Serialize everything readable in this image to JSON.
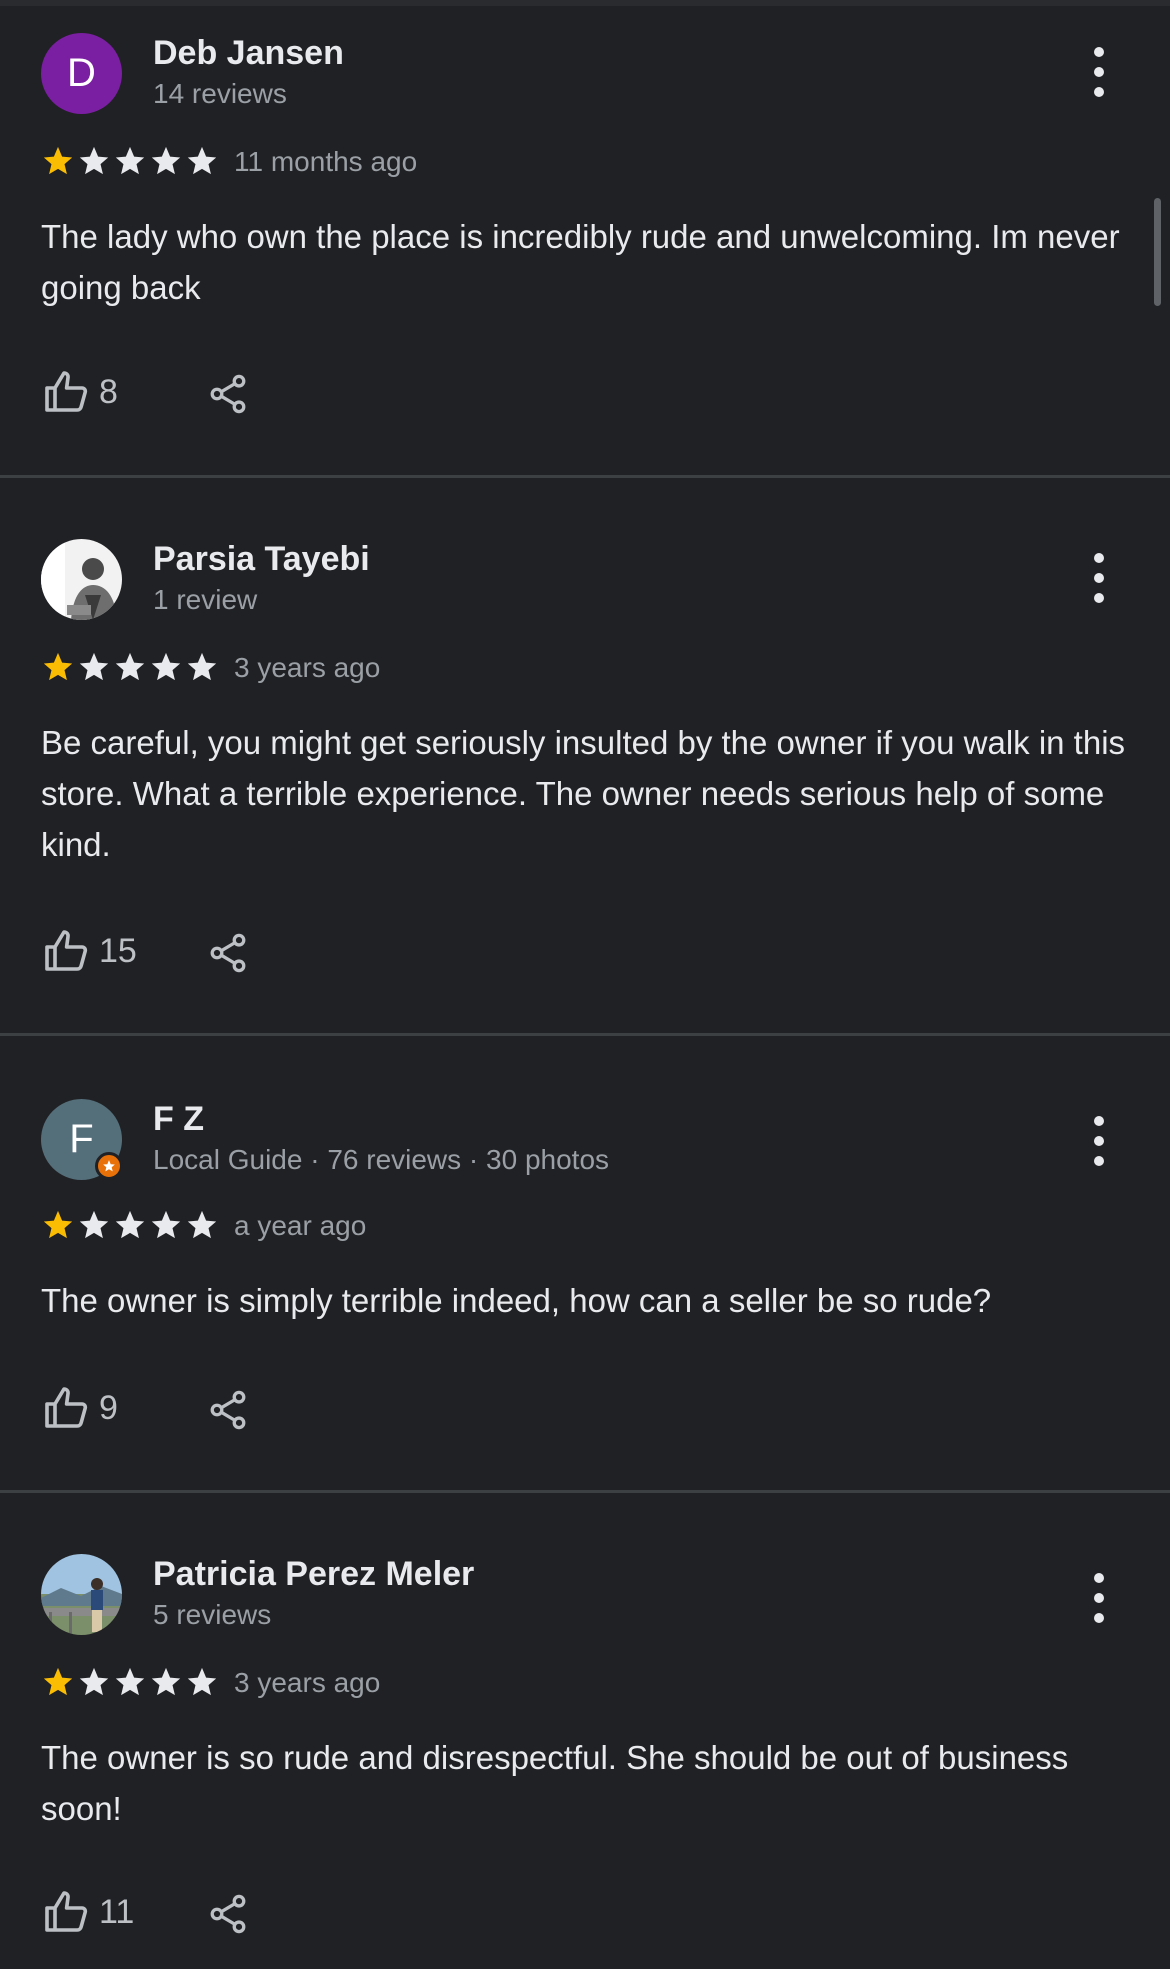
{
  "reviews": [
    {
      "name": "Deb Jansen",
      "meta": "14 reviews",
      "avatar_letter": "D",
      "avatar_color": "#7b1fa2",
      "rating": 1,
      "age": "11 months ago",
      "text": "The lady who own the place is incredibly rude and unwelcoming. Im never going back",
      "likes": "8"
    },
    {
      "name": "Parsia Tayebi",
      "meta": "1 review",
      "avatar_photo": "portrait-photo",
      "rating": 1,
      "age": "3 years ago",
      "text": "Be careful, you might get seriously insulted by the owner if you walk in this store. What a terrible experience. The owner needs serious help of some kind.",
      "likes": "15"
    },
    {
      "name": "F Z",
      "meta": "Local Guide · 76 reviews · 30 photos",
      "avatar_letter": "F",
      "avatar_color": "#546e7a",
      "local_guide_badge": true,
      "rating": 1,
      "age": "a year ago",
      "text": "The owner is simply terrible indeed, how can a seller be so rude?",
      "likes": "9"
    },
    {
      "name": "Patricia Perez Meler",
      "meta": "5 reviews",
      "avatar_photo": "landscape-photo",
      "rating": 1,
      "age": "3 years ago",
      "text": "The owner is so rude and disrespectful. She should be out of business soon!",
      "likes": "11"
    }
  ],
  "colors": {
    "background": "#202124",
    "star_filled": "#fbbc04",
    "star_empty": "#e8eaed",
    "divider": "#3c4043",
    "secondary_text": "#9aa0a6"
  },
  "icons": [
    "more-vert-icon",
    "star-icon",
    "thumbs-up-icon",
    "share-icon",
    "local-guide-badge-icon"
  ]
}
